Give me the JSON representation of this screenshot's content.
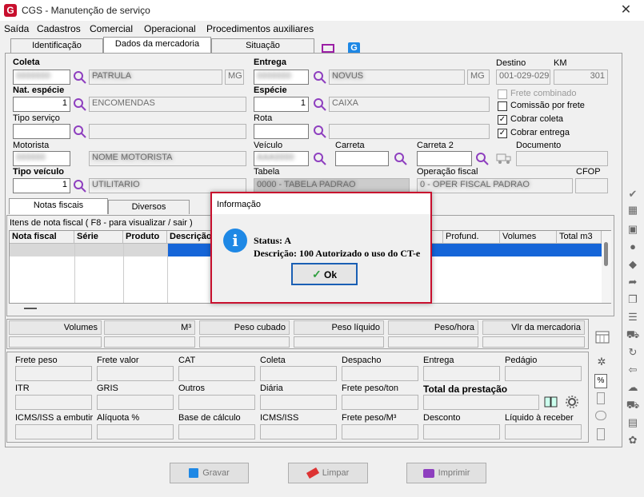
{
  "window": {
    "title": "CGS - Manutenção de serviço",
    "close_glyph": "✕"
  },
  "menu": [
    "Saída",
    "Cadastros",
    "Comercial",
    "Operacional",
    "Procedimentos auxiliares"
  ],
  "tabs": [
    "Identificação",
    "Dados da mercadoria",
    "Situação"
  ],
  "form": {
    "coleta_label": "Coleta",
    "coleta_uf": "MG",
    "entrega_label": "Entrega",
    "entrega_uf": "MG",
    "destino_label": "Destino",
    "destino_value": "001-029-029",
    "km_label": "KM",
    "km_value": "301",
    "nat_especie_label": "Nat. espécie",
    "nat_especie_qty": "1",
    "nat_especie_desc": "ENCOMENDAS",
    "especie_label": "Espécie",
    "especie_qty": "1",
    "especie_desc": "CAIXA",
    "frete_combinado": "Frete combinado",
    "comissao": "Comissão por frete",
    "cobrar_coleta": "Cobrar coleta",
    "cobrar_entrega": "Cobrar entrega",
    "tipo_servico_label": "Tipo serviço",
    "rota_label": "Rota",
    "motorista_label": "Motorista",
    "veiculo_label": "Veículo",
    "carreta_label": "Carreta",
    "carreta2_label": "Carreta 2",
    "documento_label": "Documento",
    "tipo_veiculo_label": "Tipo veículo",
    "tipo_veiculo_qty": "1",
    "tabela_label": "Tabela",
    "operacao_label": "Operação fiscal",
    "cfop_label": "CFOP"
  },
  "subtabs": [
    "Notas fiscais",
    "Diversos"
  ],
  "nf_group": "Itens de nota fiscal ( F8 - para visualizar / sair )",
  "nf_columns": [
    "Nota fiscal",
    "Série",
    "Produto",
    "Descrição"
  ],
  "nf_columns_right": [
    "Profund.",
    "Volumes",
    "Total m3"
  ],
  "totals_headers": [
    "Volumes",
    "M³",
    "Peso cubado",
    "Peso líquido",
    "Peso/hora",
    "Vlr da mercadoria"
  ],
  "frete_row1": [
    "Frete peso",
    "Frete valor",
    "CAT",
    "Coleta",
    "Despacho",
    "Entrega",
    "Pedágio"
  ],
  "frete_row2": [
    "ITR",
    "GRIS",
    "Outros",
    "Diária",
    "Frete peso/ton",
    "Total da prestação"
  ],
  "frete_row3": [
    "ICMS/ISS a embutir",
    "Alíquota %",
    "Base de cálculo",
    "ICMS/ISS",
    "Frete peso/M³",
    "Desconto",
    "Líquido à receber"
  ],
  "buttons": {
    "gravar": "Gravar",
    "limpar": "Limpar",
    "imprimir": "Imprimir"
  },
  "dialog": {
    "title": "Informação",
    "status": "Status: A",
    "descricao": "Descrição: 100 Autorizado o uso do CT-e",
    "ok": "Ok"
  }
}
